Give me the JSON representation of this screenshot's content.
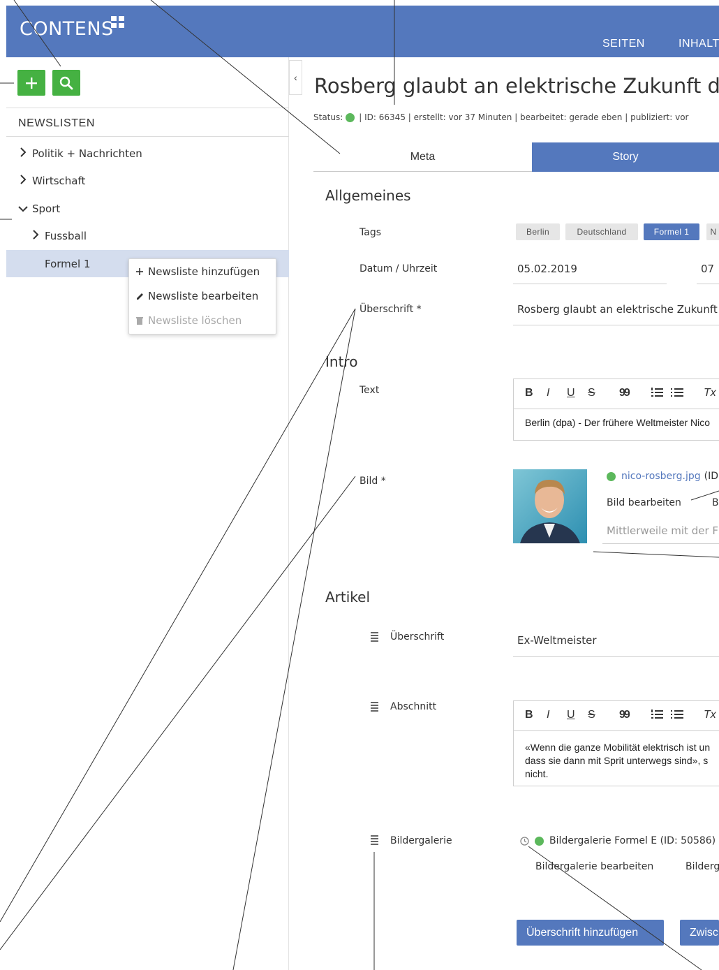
{
  "header": {
    "logo": "CONTENS",
    "nav": [
      "SEITEN",
      "INHALT"
    ]
  },
  "sidebar": {
    "add_label": "+",
    "heading": "NEWSLISTEN",
    "items": [
      {
        "label": "Politik + Nachrichten",
        "state": "collapsed"
      },
      {
        "label": "Wirtschaft",
        "state": "collapsed"
      },
      {
        "label": "Sport",
        "state": "expanded"
      },
      {
        "label": "Fussball",
        "state": "collapsed"
      },
      {
        "label": "Formel 1",
        "state": "selected"
      }
    ],
    "context_menu": [
      {
        "icon": "+",
        "label": "Newsliste hinzufügen"
      },
      {
        "icon": "pencil-icon",
        "label": "Newsliste bearbeiten"
      },
      {
        "icon": "trash-icon",
        "label": "Newsliste löschen"
      }
    ]
  },
  "collapse_label": "‹",
  "article": {
    "title": "Rosberg glaubt an elektrische Zukunft der",
    "status_label": "Status:",
    "meta_rest": "| ID: 66345 | erstellt: vor 37 Minuten | bearbeitet: gerade eben | publiziert: vor",
    "tabs": [
      "Meta",
      "Story"
    ]
  },
  "allgemeines": {
    "title": "Allgemeines",
    "tags_label": "Tags",
    "tags": [
      "Berlin",
      "Deutschland",
      "Formel 1",
      "N"
    ],
    "datetime_label": "Datum / Uhrzeit",
    "date": "05.02.2019",
    "time": "07",
    "headline_label": "Überschrift *",
    "headline_value": "Rosberg glaubt an elektrische Zukunft"
  },
  "intro": {
    "title": "Intro",
    "text_label": "Text",
    "text_value": "Berlin (dpa) - Der frühere Weltmeister Nico",
    "image_label": "Bild *",
    "image_file": "nico-rosberg.jpg",
    "image_file_suffix": "(ID",
    "image_edit": "Bild bearbeiten",
    "image_edit2": "B",
    "image_caption": "Mittlerweile mit der F"
  },
  "editor_toolbar": {
    "bold": "B",
    "italic": "I",
    "underline": "U",
    "strike": "S",
    "quote": "99",
    "clear": "Tx"
  },
  "artikel": {
    "title": "Artikel",
    "heading_label": "Überschrift",
    "heading_value": "Ex-Weltmeister",
    "section_label": "Abschnitt",
    "section_lines": [
      "«Wenn die ganze Mobilität elektrisch ist un",
      "dass sie dann mit Sprit unterwegs sind», s",
      "nicht."
    ],
    "gallery_label": "Bildergalerie",
    "gallery_value": "Bildergalerie Formel E (ID: 50586)",
    "gallery_edit": "Bildergalerie bearbeiten",
    "gallery_edit2": "Bilderg",
    "btn_add_heading": "Überschrift hinzufügen",
    "btn_add_other": "Zwisc"
  },
  "colors": {
    "primary": "#5478bd",
    "green": "#45b142",
    "status_green": "#5cb85c",
    "selected_bg": "#d4ddee"
  }
}
